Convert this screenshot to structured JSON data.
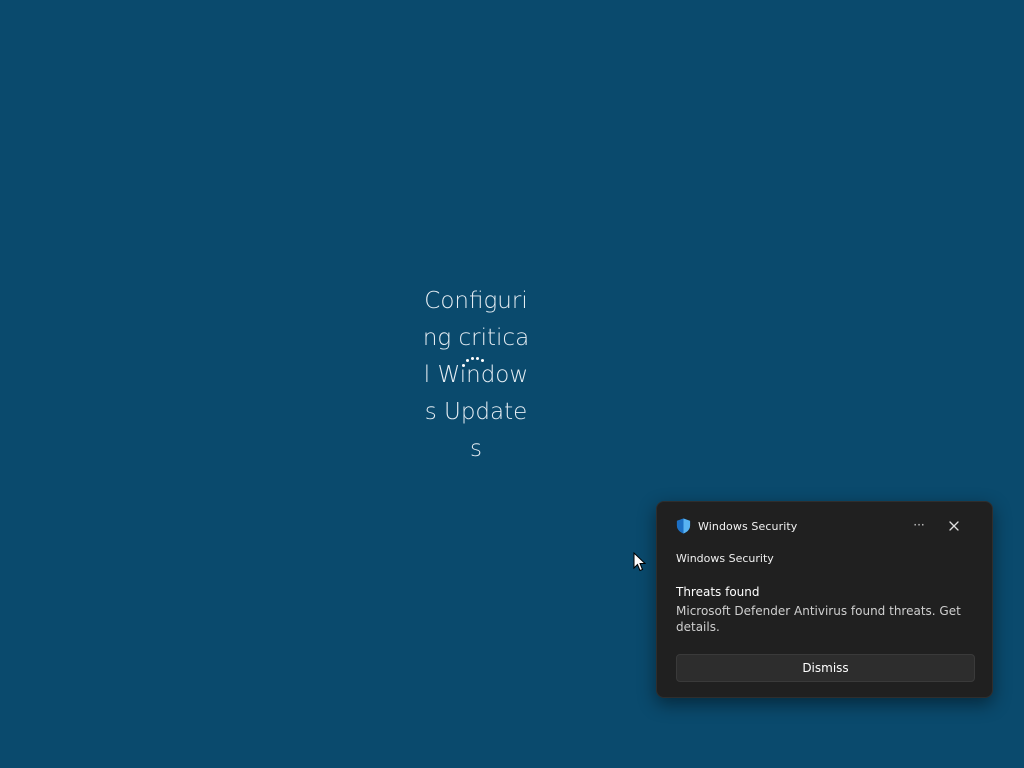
{
  "update_screen": {
    "message": "Configuring critical Windows Updates",
    "text_color": "#e6eef4",
    "background_color": "#0a4a6d",
    "spinner_icon": "loading-dots-icon"
  },
  "cursor": {
    "icon": "mouse-pointer-icon"
  },
  "notification": {
    "app_name": "Windows Security",
    "app_icon": "windows-security-shield-icon",
    "more_label": "···",
    "close_icon": "close-icon",
    "source": "Windows Security",
    "title": "Threats found",
    "body": "Microsoft Defender Antivirus found threats. Get details.",
    "dismiss_label": "Dismiss",
    "background_color": "#202020",
    "accent_color": "#2b8fe0"
  }
}
